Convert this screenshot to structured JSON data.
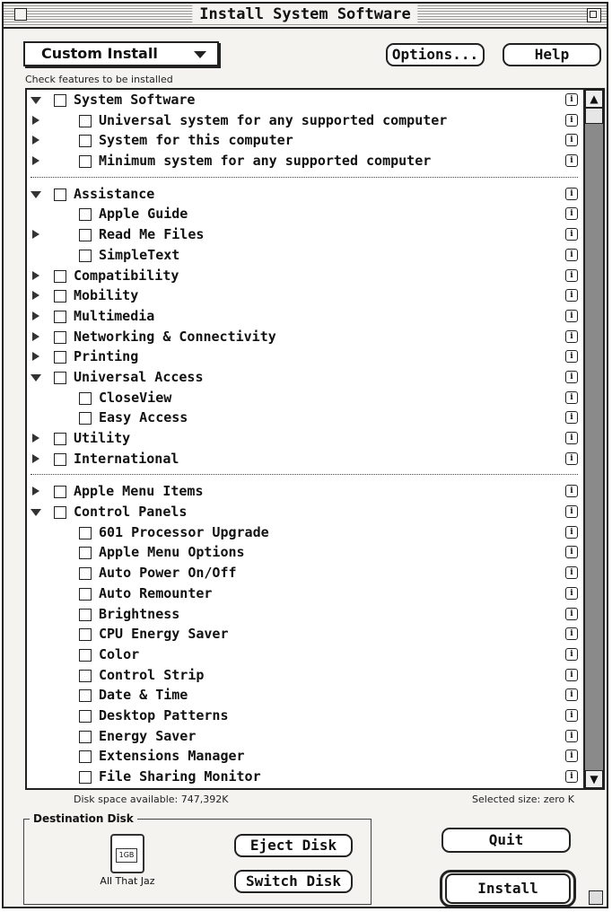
{
  "window": {
    "title": "Install System Software"
  },
  "install_type": {
    "selected": "Custom Install"
  },
  "buttons": {
    "options": "Options...",
    "help": "Help",
    "quit": "Quit",
    "install": "Install",
    "eject": "Eject Disk",
    "switch": "Switch Disk"
  },
  "hint": "Check features to be installed",
  "groups": [
    [
      {
        "label": "System Software",
        "level": 0,
        "toggle": "down"
      },
      {
        "label": "Universal system for any supported computer",
        "level": 1,
        "toggle": "right"
      },
      {
        "label": "System for this computer",
        "level": 1,
        "toggle": "right"
      },
      {
        "label": "Minimum system for any supported computer",
        "level": 1,
        "toggle": "right"
      }
    ],
    [
      {
        "label": "Assistance",
        "level": 0,
        "toggle": "down"
      },
      {
        "label": "Apple Guide",
        "level": 1,
        "toggle": "none"
      },
      {
        "label": "Read Me Files",
        "level": 1,
        "toggle": "right"
      },
      {
        "label": "SimpleText",
        "level": 1,
        "toggle": "none"
      },
      {
        "label": "Compatibility",
        "level": 0,
        "toggle": "right"
      },
      {
        "label": "Mobility",
        "level": 0,
        "toggle": "right"
      },
      {
        "label": "Multimedia",
        "level": 0,
        "toggle": "right"
      },
      {
        "label": "Networking & Connectivity",
        "level": 0,
        "toggle": "right"
      },
      {
        "label": "Printing",
        "level": 0,
        "toggle": "right"
      },
      {
        "label": "Universal Access",
        "level": 0,
        "toggle": "down"
      },
      {
        "label": "CloseView",
        "level": 1,
        "toggle": "none"
      },
      {
        "label": "Easy Access",
        "level": 1,
        "toggle": "none"
      },
      {
        "label": "Utility",
        "level": 0,
        "toggle": "right"
      },
      {
        "label": "International",
        "level": 0,
        "toggle": "right"
      }
    ],
    [
      {
        "label": "Apple Menu Items",
        "level": 0,
        "toggle": "right"
      },
      {
        "label": "Control Panels",
        "level": 0,
        "toggle": "down"
      },
      {
        "label": "601 Processor Upgrade",
        "level": 1,
        "toggle": "none"
      },
      {
        "label": "Apple Menu Options",
        "level": 1,
        "toggle": "none"
      },
      {
        "label": "Auto Power On/Off",
        "level": 1,
        "toggle": "none"
      },
      {
        "label": "Auto Remounter",
        "level": 1,
        "toggle": "none"
      },
      {
        "label": "Brightness",
        "level": 1,
        "toggle": "none"
      },
      {
        "label": "CPU Energy Saver",
        "level": 1,
        "toggle": "none"
      },
      {
        "label": "Color",
        "level": 1,
        "toggle": "none"
      },
      {
        "label": "Control Strip",
        "level": 1,
        "toggle": "none"
      },
      {
        "label": "Date & Time",
        "level": 1,
        "toggle": "none"
      },
      {
        "label": "Desktop Patterns",
        "level": 1,
        "toggle": "none"
      },
      {
        "label": "Energy Saver",
        "level": 1,
        "toggle": "none"
      },
      {
        "label": "Extensions Manager",
        "level": 1,
        "toggle": "none"
      },
      {
        "label": "File Sharing Monitor",
        "level": 1,
        "toggle": "none"
      }
    ]
  ],
  "status": {
    "disk_space": "Disk space available: 747,392K",
    "selected_size": "Selected size: zero K"
  },
  "destination": {
    "legend": "Destination Disk",
    "disk_name": "All That Jaz",
    "disk_badge": "1GB"
  },
  "info_glyph": "i",
  "icons": {
    "toggle_expand": "disclosure-triangle-right",
    "toggle_collapse": "disclosure-triangle-down",
    "info": "info-icon",
    "scroll_up": "up-arrow-icon",
    "scroll_down": "down-arrow-icon"
  }
}
